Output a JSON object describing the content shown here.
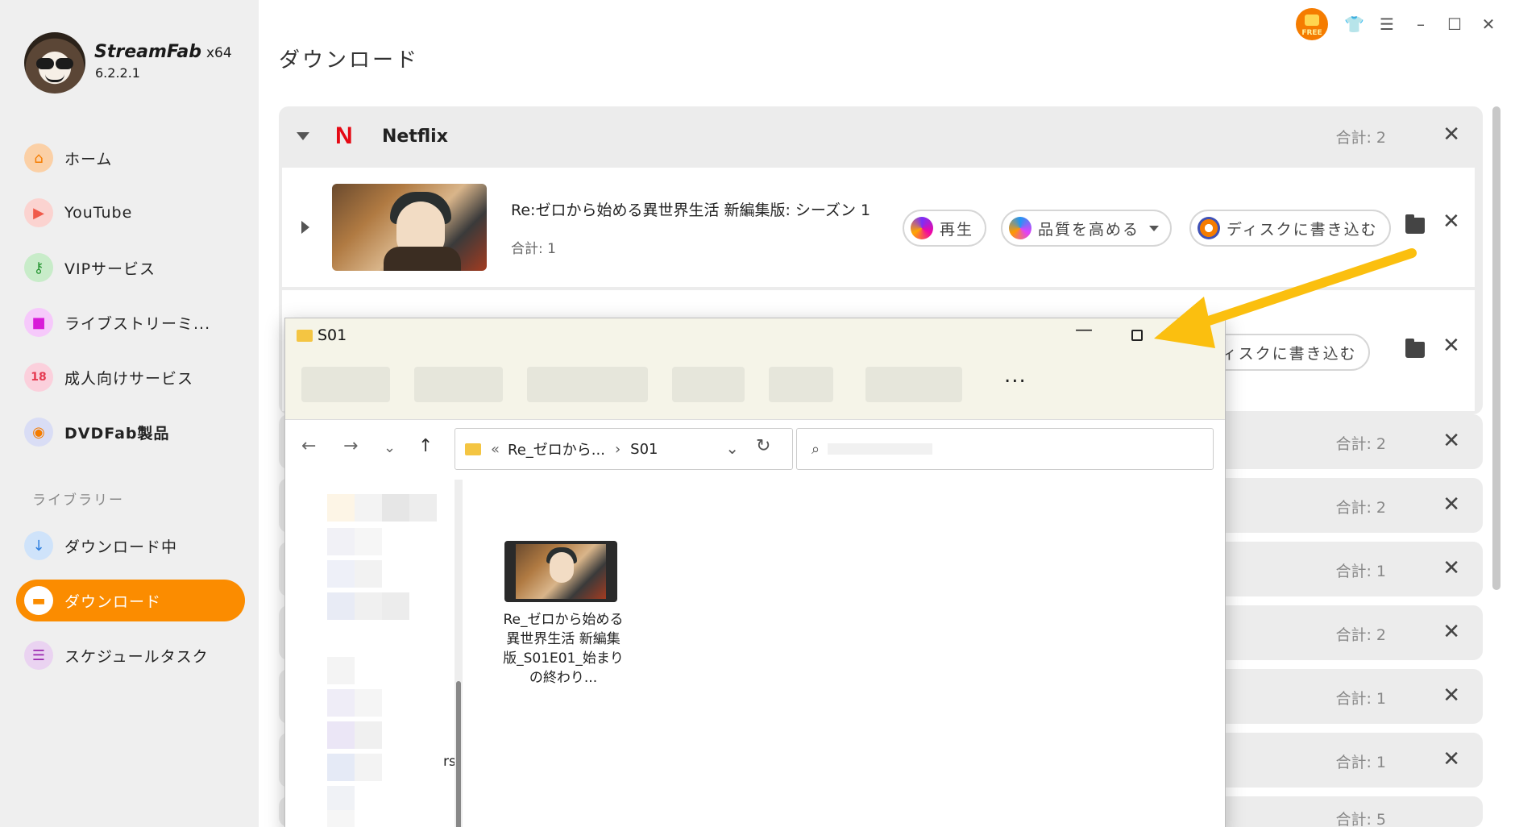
{
  "app": {
    "brand": "StreamFab",
    "arch": "x64",
    "version": "6.2.2.1",
    "accent": "#fb8c00",
    "free_badge": "FREE"
  },
  "sidebar": {
    "items": [
      {
        "label": "ホーム",
        "icon": "home-icon",
        "color": "#f6a04a"
      },
      {
        "label": "YouTube",
        "icon": "youtube-icon",
        "color": "#f05a4a"
      },
      {
        "label": "VIPサービス",
        "icon": "key-icon",
        "color": "#4caf50"
      },
      {
        "label": "ライブストリーミ...",
        "icon": "video-camera-icon",
        "color": "#e040fb"
      },
      {
        "label": "成人向けサービス",
        "icon": "adult-icon",
        "color": "#f06292"
      },
      {
        "label": "DVDFab製品",
        "icon": "dvdfab-icon",
        "color": "#3f51b5"
      }
    ],
    "library_label": "ライブラリー",
    "library": [
      {
        "label": "ダウンロード中",
        "icon": "download-arrow-icon",
        "color": "#3d8fe6"
      },
      {
        "label": "ダウンロード",
        "icon": "folder-icon",
        "color": "#fb8c00",
        "active": true
      },
      {
        "label": "スケジュールタスク",
        "icon": "schedule-icon",
        "color": "#ab47bc"
      }
    ]
  },
  "main": {
    "title": "ダウンロード",
    "group": {
      "name": "Netflix",
      "logo": "N",
      "total": "合計: 2"
    },
    "item": {
      "title": "Re:ゼロから始める異世界生活 新編集版: シーズン 1",
      "total": "合計: 1",
      "play_label": "再生",
      "quality_label": "品質を高める",
      "burn_label": "ディスクに書き込む"
    },
    "row2_burn_label": "ディスクに書き込む",
    "other_groups": [
      {
        "total": "合計: 2"
      },
      {
        "total": "合計: 2"
      },
      {
        "total": "合計: 1"
      },
      {
        "total": "合計: 2"
      },
      {
        "total": "合計: 1"
      },
      {
        "total": "合計: 1"
      },
      {
        "total": "合計: 5"
      }
    ]
  },
  "explorer": {
    "title": "S01",
    "more": "...",
    "path_prefix": "«",
    "path_parent": "Re_ゼロから...",
    "path_sep": "›",
    "path_current": "S01",
    "left_label_fragment": "rs",
    "file_name": "Re_ゼロから始める異世界生活 新編集版_S01E01_始まりの終わり..."
  }
}
